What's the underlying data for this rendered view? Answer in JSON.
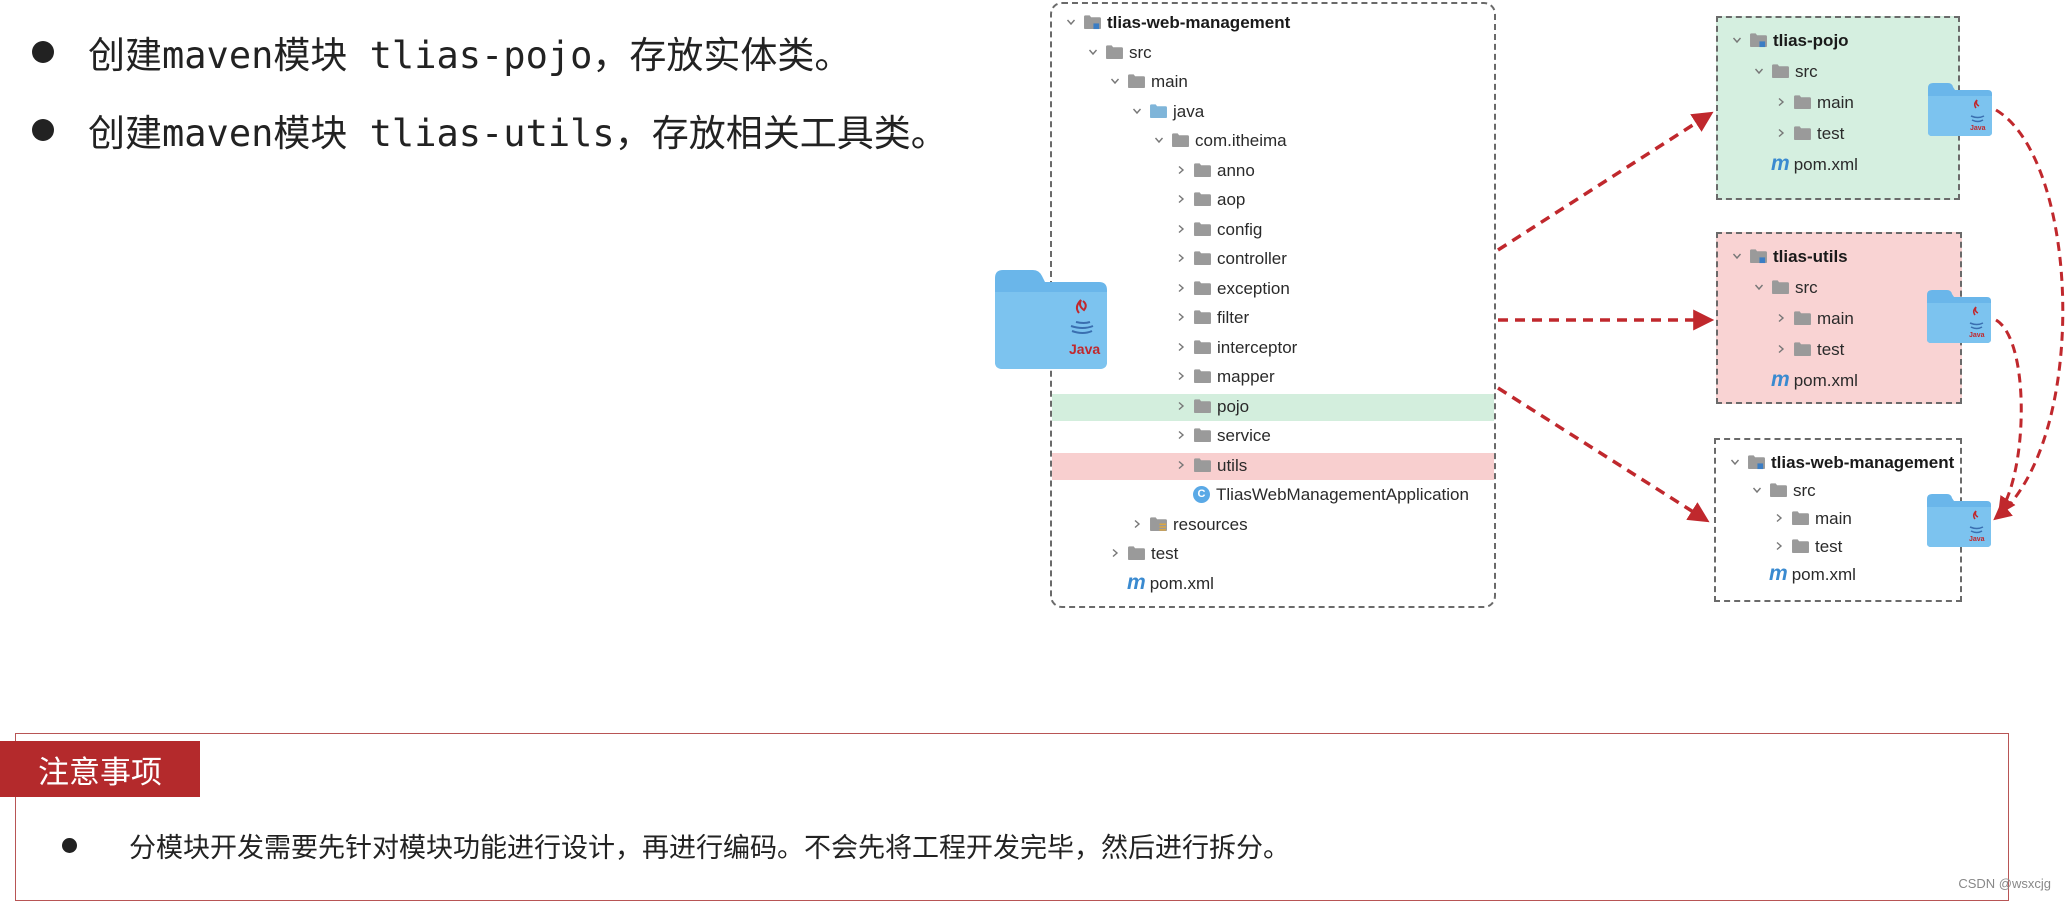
{
  "bullets": [
    "创建maven模块 tlias-pojo，存放实体类。",
    "创建maven模块 tlias-utils，存放相关工具类。"
  ],
  "main_tree": {
    "root": "tlias-web-management",
    "src": "src",
    "main": "main",
    "java": "java",
    "package": "com.itheima",
    "packages": [
      "anno",
      "aop",
      "config",
      "controller",
      "exception",
      "filter",
      "interceptor",
      "mapper",
      "pojo",
      "service",
      "utils"
    ],
    "app_class": "TliasWebManagementApplication",
    "app_class_icon": "C",
    "resources": "resources",
    "test": "test",
    "pom": "pom.xml",
    "pom_icon": "m",
    "highlight_green": "pojo",
    "highlight_red": "utils"
  },
  "java_icon_label": "Java",
  "modules": [
    {
      "root": "tlias-pojo",
      "src": "src",
      "main": "main",
      "test": "test",
      "pom": "pom.xml",
      "bg": "#d5efe0"
    },
    {
      "root": "tlias-utils",
      "src": "src",
      "main": "main",
      "test": "test",
      "pom": "pom.xml",
      "bg": "#f9d3d3"
    },
    {
      "root": "tlias-web-management",
      "src": "src",
      "main": "main",
      "test": "test",
      "pom": "pom.xml",
      "bg": "#ffffff"
    }
  ],
  "notice": {
    "title": "注意事项",
    "text": "分模块开发需要先针对模块功能进行设计，再进行编码。不会先将工程开发完毕，然后进行拆分。"
  },
  "watermark": "CSDN @wsxcjg",
  "colors": {
    "arrow": "#c0282d",
    "folder": "#6ab6ea",
    "folder_tab": "#4aa2df",
    "tree_folder": "#9a9a9a",
    "notice_tag": "#b42a2c",
    "green_highlight": "#d3eedd",
    "red_highlight": "#f8cfcf"
  }
}
